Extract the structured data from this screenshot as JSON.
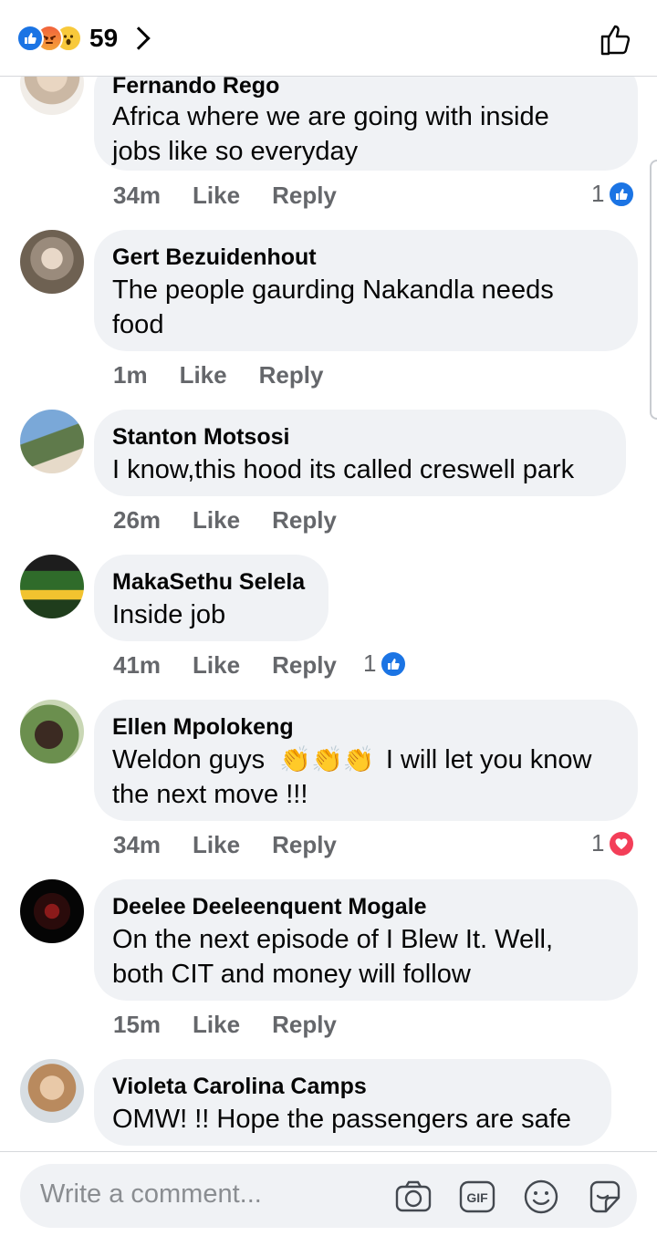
{
  "header": {
    "reaction_count": "59",
    "reactions": [
      "like-icon",
      "angry-icon",
      "wow-icon"
    ]
  },
  "comments": [
    {
      "author": "Fernando Rego",
      "text_lines": [
        "Africa where we are going with inside",
        "jobs like so everyday"
      ],
      "time": "34m",
      "like_label": "Like",
      "reply_label": "Reply",
      "reaction_count": "1",
      "reaction_type": "like"
    },
    {
      "author": "Gert Bezuidenhout",
      "text_lines": [
        "The people gaurding Nakandla needs",
        "food"
      ],
      "time": "1m",
      "like_label": "Like",
      "reply_label": "Reply"
    },
    {
      "author": "Stanton Motsosi",
      "text_lines": [
        "I know,this hood its called creswell park"
      ],
      "time": "26m",
      "like_label": "Like",
      "reply_label": "Reply"
    },
    {
      "author": "MakaSethu Selela",
      "text_lines": [
        "Inside job"
      ],
      "time": "41m",
      "like_label": "Like",
      "reply_label": "Reply",
      "reaction_count": "1",
      "reaction_type": "like"
    },
    {
      "author": "Ellen Mpolokeng",
      "text_lines": [
        "Weldon guys",
        "I will let you know",
        "the next move !!!"
      ],
      "time": "34m",
      "like_label": "Like",
      "reply_label": "Reply",
      "reaction_count": "1",
      "reaction_type": "love"
    },
    {
      "author": "Deelee Deeleenquent Mogale",
      "text_lines": [
        "On the next episode of I Blew It. Well,",
        "both CIT and money will follow"
      ],
      "time": "15m",
      "like_label": "Like",
      "reply_label": "Reply"
    },
    {
      "author": "Violeta Carolina Camps",
      "text_lines": [
        "OMW! !! Hope the passengers are safe"
      ]
    }
  ],
  "composer": {
    "placeholder": "Write a comment...",
    "gif_label": "GIF"
  }
}
